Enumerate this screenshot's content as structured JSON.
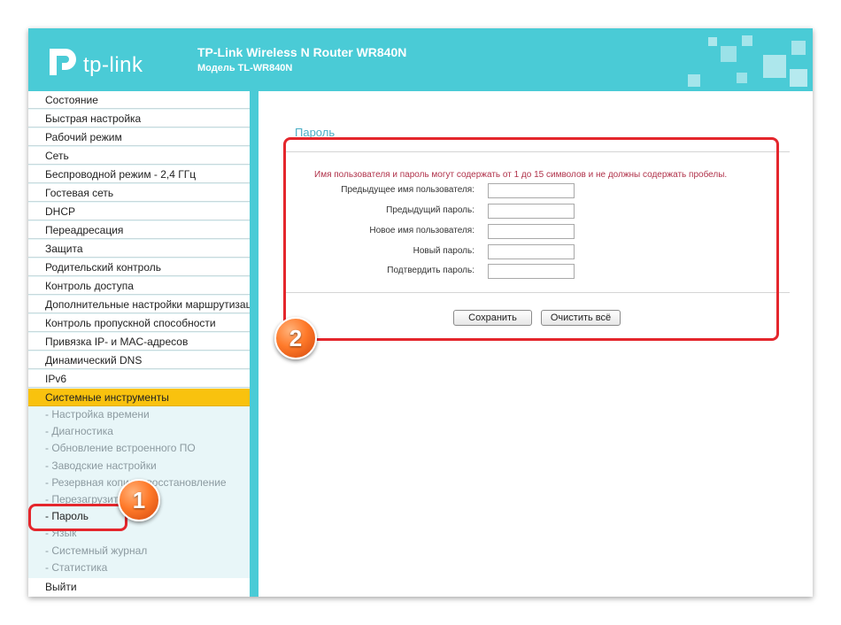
{
  "header": {
    "logo_text": "tp-link",
    "title": "TP-Link Wireless N Router WR840N",
    "model": "Модель TL-WR840N"
  },
  "sidebar": {
    "items": [
      {
        "label": "Состояние"
      },
      {
        "label": "Быстрая настройка"
      },
      {
        "label": "Рабочий режим"
      },
      {
        "label": "Сеть"
      },
      {
        "label": "Беспроводной режим - 2,4 ГГц"
      },
      {
        "label": "Гостевая сеть"
      },
      {
        "label": "DHCP"
      },
      {
        "label": "Переадресация"
      },
      {
        "label": "Защита"
      },
      {
        "label": "Родительский контроль"
      },
      {
        "label": "Контроль доступа"
      },
      {
        "label": "Дополнительные настройки маршрутизации"
      },
      {
        "label": "Контроль пропускной способности"
      },
      {
        "label": "Привязка IP- и MAC-адресов"
      },
      {
        "label": "Динамический DNS"
      },
      {
        "label": "IPv6"
      },
      {
        "label": "Системные инструменты"
      }
    ],
    "subitems": [
      {
        "label": "- Настройка времени"
      },
      {
        "label": "- Диагностика"
      },
      {
        "label": "- Обновление встроенного ПО"
      },
      {
        "label": "- Заводские настройки"
      },
      {
        "label": "- Резервная копия и восстановление"
      },
      {
        "label": "- Перезагрузить"
      },
      {
        "label": "- Пароль"
      },
      {
        "label": "- Язык"
      },
      {
        "label": "- Системный журнал"
      },
      {
        "label": "- Статистика"
      }
    ],
    "logout": "Выйти"
  },
  "main": {
    "page_title": "Пароль",
    "note": "Имя пользователя и пароль могут содержать от 1 до 15 символов и не должны содержать пробелы.",
    "fields": [
      {
        "label": "Предыдущее имя пользователя:",
        "value": ""
      },
      {
        "label": "Предыдущий пароль:",
        "value": ""
      },
      {
        "label": "Новое имя пользователя:",
        "value": ""
      },
      {
        "label": "Новый пароль:",
        "value": ""
      },
      {
        "label": "Подтвердить пароль:",
        "value": ""
      }
    ],
    "save_label": "Сохранить",
    "clear_label": "Очистить всё"
  },
  "annotations": {
    "badge1": "1",
    "badge2": "2"
  },
  "colors": {
    "header_bg": "#4acbd6",
    "active_menu": "#f9c20e",
    "highlight_red": "#e4262c",
    "note_text": "#b0324a",
    "page_title": "#4aaec6"
  }
}
